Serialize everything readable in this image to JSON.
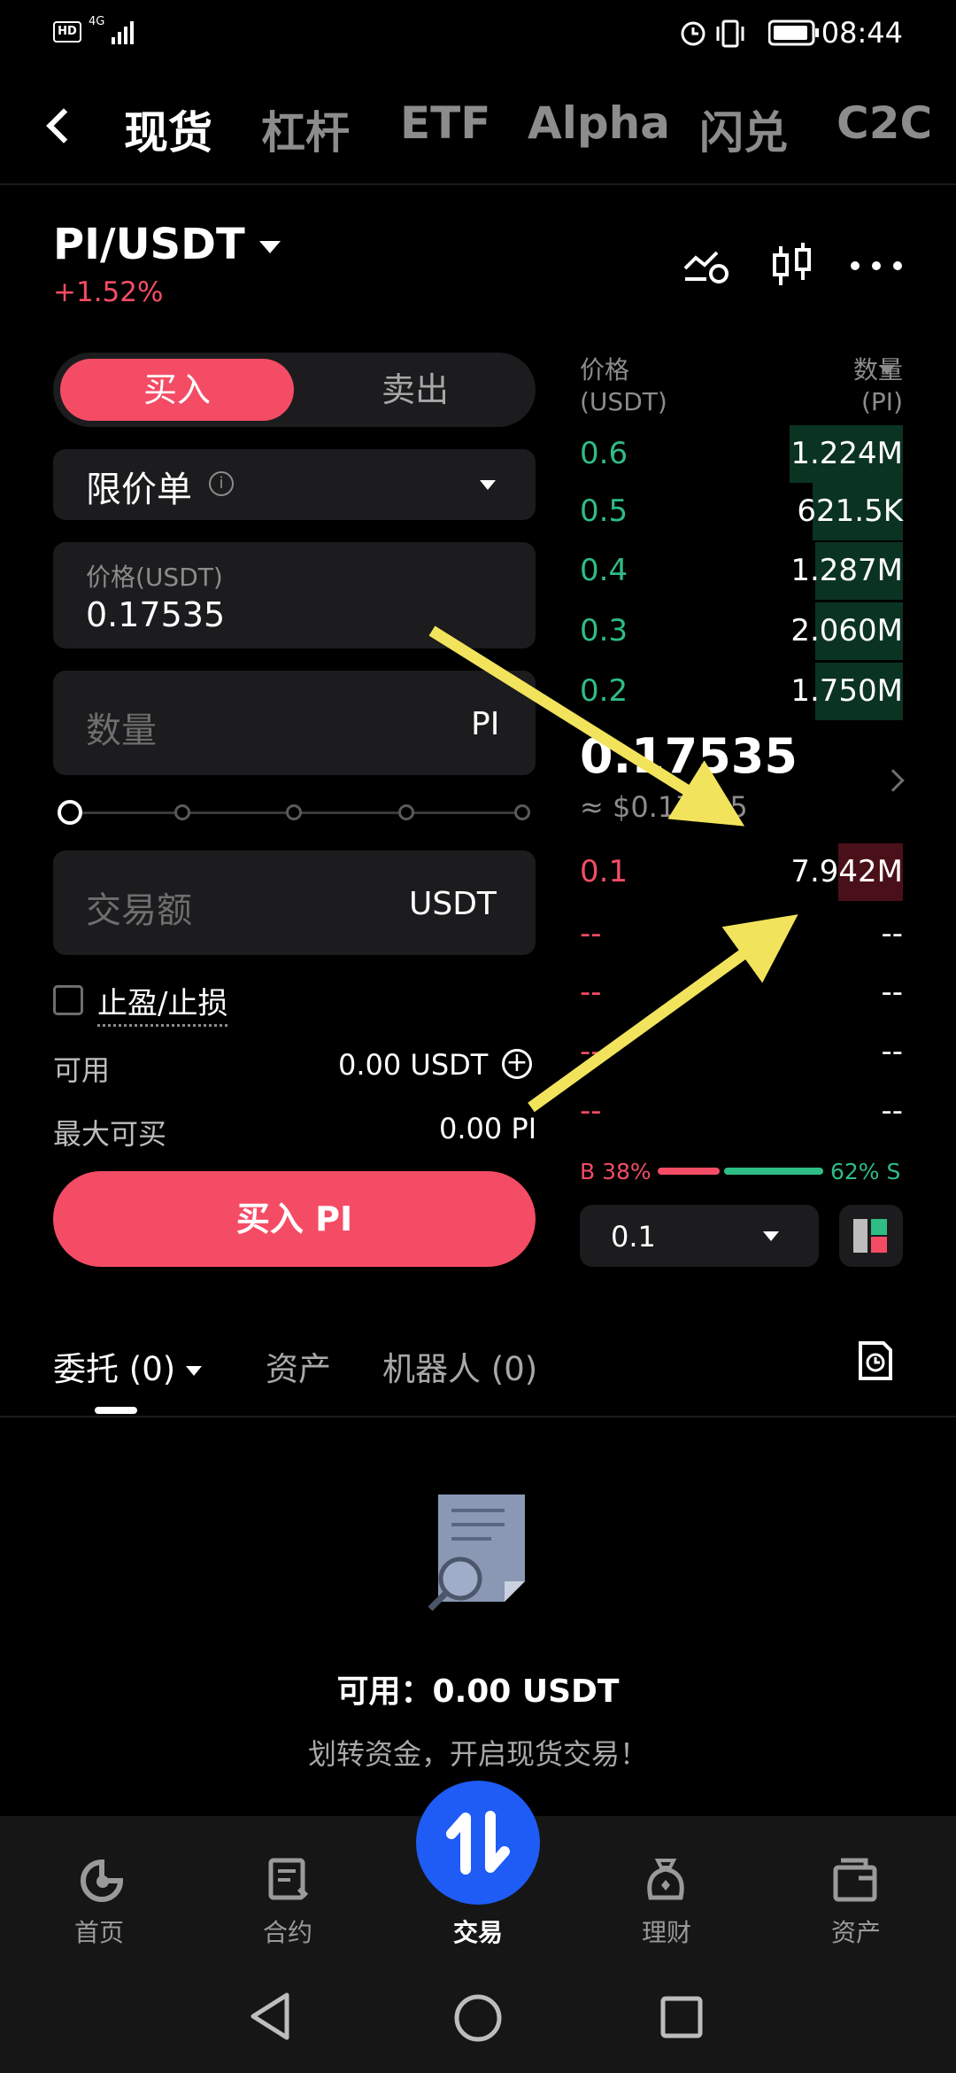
{
  "status_bar": {
    "hd": "HD",
    "net": "4G",
    "time": "08:44"
  },
  "top_tabs": [
    "现货",
    "杠杆",
    "ETF",
    "Alpha",
    "闪兑",
    "C2C"
  ],
  "pair": {
    "symbol": "PI/USDT",
    "change": "+1.52%"
  },
  "order_form": {
    "side_buy": "买入",
    "side_sell": "卖出",
    "order_type": "限价单",
    "price_label": "价格(USDT)",
    "price_value": "0.17535",
    "qty_placeholder": "数量",
    "qty_unit": "PI",
    "amount_placeholder": "交易额",
    "amount_unit": "USDT",
    "tpsl_label": "止盈/止损",
    "available_label": "可用",
    "available_value": "0.00 USDT",
    "max_buy_label": "最大可买",
    "max_buy_value": "0.00 PI",
    "buy_button": "买入 PI"
  },
  "order_book": {
    "price_header": "价格\n(USDT)",
    "qty_header": "数量\n(PI)",
    "asks": [
      {
        "price": "0.6",
        "qty": "1.224M",
        "depth": 0.35
      },
      {
        "price": "0.5",
        "qty": "621.5K",
        "depth": 0.28
      },
      {
        "price": "0.4",
        "qty": "1.287M",
        "depth": 0.27
      },
      {
        "price": "0.3",
        "qty": "2.060M",
        "depth": 0.27
      },
      {
        "price": "0.2",
        "qty": "1.750M",
        "depth": 0.27
      }
    ],
    "last_price": "0.17535",
    "last_price_usd": "≈ $0.17535",
    "bids": [
      {
        "price": "0.1",
        "qty": "7.942M",
        "depth": 0.2
      },
      {
        "price": "--",
        "qty": "--",
        "depth": 0
      },
      {
        "price": "--",
        "qty": "--",
        "depth": 0
      },
      {
        "price": "--",
        "qty": "--",
        "depth": 0
      },
      {
        "price": "--",
        "qty": "--",
        "depth": 0
      }
    ],
    "buy_ratio": "B 38%",
    "sell_ratio": "62% S",
    "precision": "0.1"
  },
  "lower_tabs": {
    "orders": "委托 (0)",
    "assets": "资产",
    "bots": "机器人 (0)"
  },
  "empty_state": {
    "title": "可用：0.00 USDT",
    "subtitle": "划转资金，开启现货交易！"
  },
  "bottom_nav": [
    "首页",
    "合约",
    "交易",
    "理财",
    "资产"
  ],
  "colors": {
    "buy": "#f44c65",
    "sell": "#2ebd85",
    "fab": "#1e5cf5",
    "arrow": "#f2e35c"
  }
}
